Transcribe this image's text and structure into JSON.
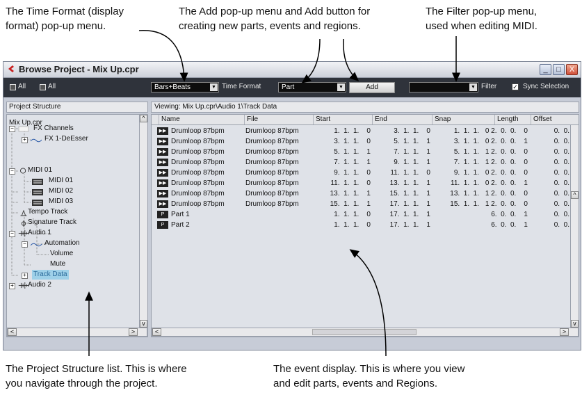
{
  "callouts": {
    "time_format_l1": "The Time Format (display",
    "time_format_l2": "format) pop-up menu.",
    "add_l1": "The Add pop-up menu and Add button for",
    "add_l2": "creating new parts, events and regions.",
    "filter_l1": "The Filter pop-up menu,",
    "filter_l2": "used when editing MIDI.",
    "structure_l1": "The Project Structure list. This is where",
    "structure_l2": "you navigate through the project.",
    "event_l1": "The event display. This is where you view",
    "event_l2": "and edit parts, events and Regions."
  },
  "window": {
    "title": "Browse Project - Mix Up.cpr",
    "minimize": "_",
    "maximize": "□",
    "close": "X"
  },
  "toolbar": {
    "all_1": "All",
    "all_2": "All",
    "time_format_value": "Bars+Beats",
    "time_format_label": "Time Format",
    "add_menu_value": "Part",
    "add_button": "Add",
    "filter_value": "",
    "filter_label": "Filter",
    "sync_checked": true,
    "sync_label": "Sync Selection"
  },
  "structure": {
    "header": "Project Structure",
    "nodes": [
      {
        "label": "Mix Up.cpr"
      },
      {
        "label": "FX Channels"
      },
      {
        "label": "FX 1-DeEsser"
      },
      {
        "label": "MIDI 01"
      },
      {
        "label": "MIDI 01"
      },
      {
        "label": "MIDI 02"
      },
      {
        "label": "MIDI 03"
      },
      {
        "label": "Tempo Track"
      },
      {
        "label": "Signature Track"
      },
      {
        "label": "Audio 1"
      },
      {
        "label": "Automation"
      },
      {
        "label": "Volume"
      },
      {
        "label": "Mute"
      },
      {
        "label": "Track Data"
      },
      {
        "label": "Audio 2"
      }
    ]
  },
  "events": {
    "viewing": "Viewing: Mix Up.cpr\\Audio 1\\Track Data",
    "columns": [
      "Name",
      "File",
      "Start",
      "End",
      "Snap",
      "Length",
      "Offset"
    ],
    "rows": [
      {
        "name": "Drumloop 87bpm",
        "file": "Drumloop 87bpm",
        "start": "1.  1.  1.    0",
        "end": "3.  1.  1.    0",
        "snap": "1.  1.  1.",
        "length": "0 2.  0.  0.    0",
        "offset": "0.  0."
      },
      {
        "name": "Drumloop 87bpm",
        "file": "Drumloop 87bpm",
        "start": "3.  1.  1.    0",
        "end": "5.  1.  1.    1",
        "snap": "3.  1.  1.",
        "length": "0 2.  0.  0.    1",
        "offset": "0.  0."
      },
      {
        "name": "Drumloop 87bpm",
        "file": "Drumloop 87bpm",
        "start": "5.  1.  1.    1",
        "end": "7.  1.  1.    1",
        "snap": "5.  1.  1.",
        "length": "1 2.  0.  0.    0",
        "offset": "0.  0."
      },
      {
        "name": "Drumloop 87bpm",
        "file": "Drumloop 87bpm",
        "start": "7.  1.  1.    1",
        "end": "9.  1.  1.    1",
        "snap": "7.  1.  1.",
        "length": "1 2.  0.  0.    0",
        "offset": "0.  0."
      },
      {
        "name": "Drumloop 87bpm",
        "file": "Drumloop 87bpm",
        "start": "9.  1.  1.    0",
        "end": "11.  1.  1.    0",
        "snap": "9.  1.  1.",
        "length": "0 2.  0.  0.    0",
        "offset": "0.  0."
      },
      {
        "name": "Drumloop 87bpm",
        "file": "Drumloop 87bpm",
        "start": "11.  1.  1.    0",
        "end": "13.  1.  1.    1",
        "snap": "11.  1.  1.",
        "length": "0 2.  0.  0.    1",
        "offset": "0.  0."
      },
      {
        "name": "Drumloop 87bpm",
        "file": "Drumloop 87bpm",
        "start": "13.  1.  1.    1",
        "end": "15.  1.  1.    1",
        "snap": "13.  1.  1.",
        "length": "1 2.  0.  0.    0",
        "offset": "0.  0."
      },
      {
        "name": "Drumloop 87bpm",
        "file": "Drumloop 87bpm",
        "start": "15.  1.  1.    1",
        "end": "17.  1.  1.    1",
        "snap": "15.  1.  1.",
        "length": "1 2.  0.  0.    0",
        "offset": "0.  0."
      },
      {
        "name": "Part 1",
        "file": "",
        "start": "1.  1.  1.    0",
        "end": "17.  1.  1.    1",
        "snap": "",
        "length": "6.  0.  0.    1",
        "offset": "0.  0."
      },
      {
        "name": "Part 2",
        "file": "",
        "start": "1.  1.  1.    0",
        "end": "17.  1.  1.    1",
        "snap": "",
        "length": "6.  0.  0.    1",
        "offset": "0.  0."
      }
    ]
  },
  "icons": {
    "app": "cubase-logo-icon",
    "audio_event": "audio-event-icon",
    "part": "part-icon"
  },
  "colors": {
    "toolbar_bg": "#2f333b",
    "panel_bg": "#dfe2e8",
    "selection_highlight": "#9ed0e8"
  }
}
